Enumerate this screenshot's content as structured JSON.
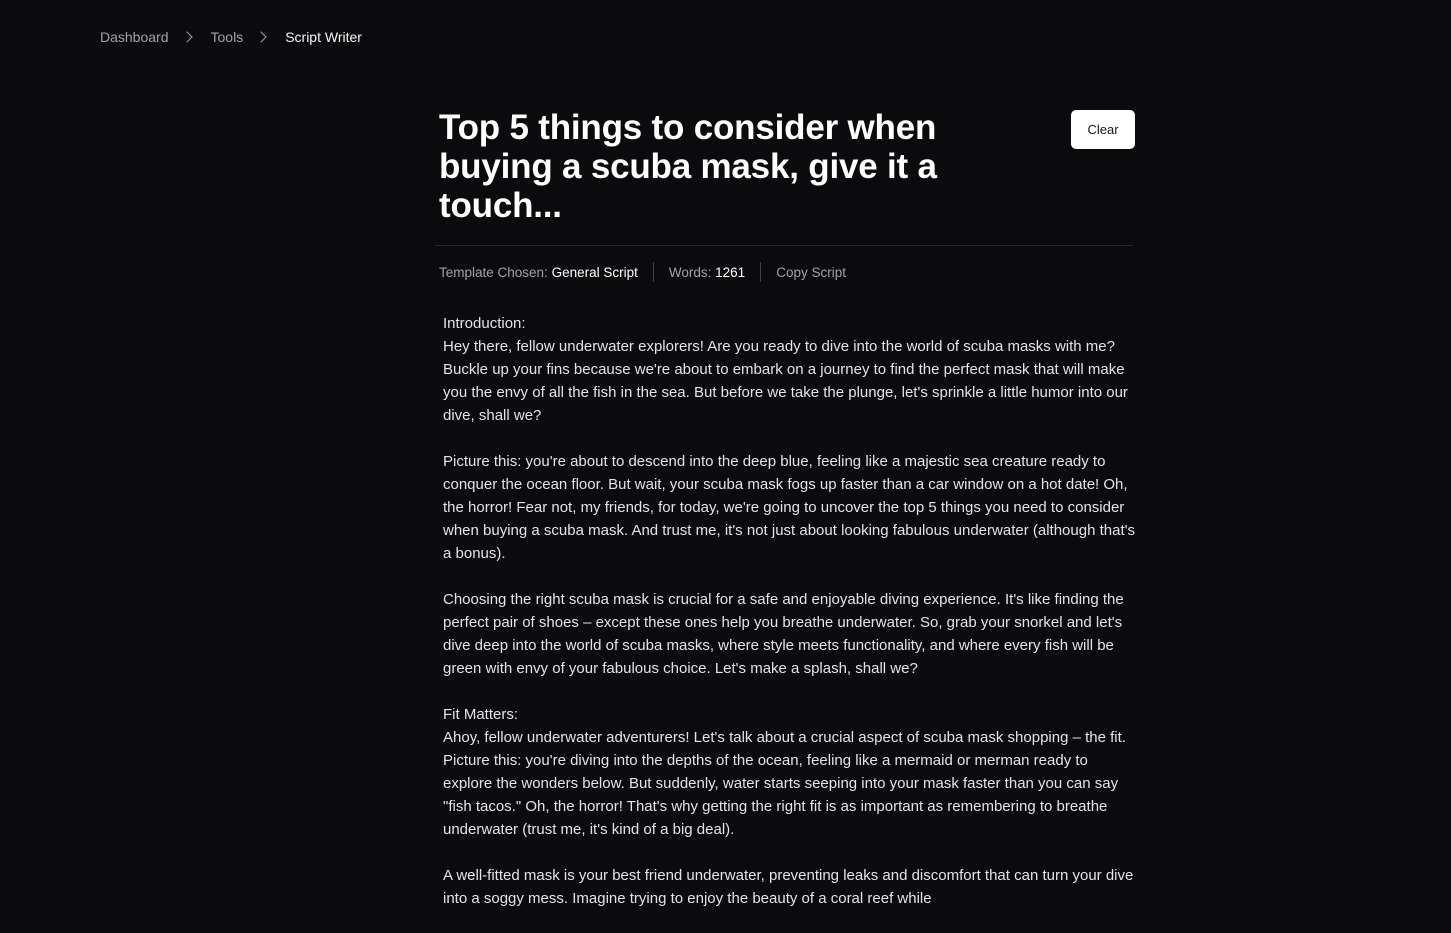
{
  "breadcrumb": {
    "items": [
      "Dashboard",
      "Tools"
    ],
    "current": "Script Writer"
  },
  "header": {
    "title": "Top 5 things to consider when buying a scuba mask, give it a touch...",
    "clear_label": "Clear"
  },
  "meta": {
    "template_label": "Template Chosen:",
    "template_value": "General Script",
    "words_label": "Words:",
    "words_value": "1261",
    "copy_label": "Copy Script"
  },
  "script": {
    "paragraphs": [
      {
        "heading": "Introduction:",
        "text": "Hey there, fellow underwater explorers! Are you ready to dive into the world of scuba masks with me? Buckle up your fins because we're about to embark on a journey to find the perfect mask that will make you the envy of all the fish in the sea. But before we take the plunge, let's sprinkle a little humor into our dive, shall we?"
      },
      {
        "heading": "",
        "text": "Picture this: you're about to descend into the deep blue, feeling like a majestic sea creature ready to conquer the ocean floor. But wait, your scuba mask fogs up faster than a car window on a hot date! Oh, the horror! Fear not, my friends, for today, we're going to uncover the top 5 things you need to consider when buying a scuba mask. And trust me, it's not just about looking fabulous underwater (although that's a bonus)."
      },
      {
        "heading": "",
        "text": "Choosing the right scuba mask is crucial for a safe and enjoyable diving experience. It's like finding the perfect pair of shoes – except these ones help you breathe underwater. So, grab your snorkel and let's dive deep into the world of scuba masks, where style meets functionality, and where every fish will be green with envy of your fabulous choice. Let's make a splash, shall we?"
      },
      {
        "heading": "Fit Matters:",
        "text": "Ahoy, fellow underwater adventurers! Let's talk about a crucial aspect of scuba mask shopping – the fit. Picture this: you're diving into the depths of the ocean, feeling like a mermaid or merman ready to explore the wonders below. But suddenly, water starts seeping into your mask faster than you can say \"fish tacos.\" Oh, the horror! That's why getting the right fit is as important as remembering to breathe underwater (trust me, it's kind of a big deal)."
      },
      {
        "heading": "",
        "text": "A well-fitted mask is your best friend underwater, preventing leaks and discomfort that can turn your dive into a soggy mess. Imagine trying to enjoy the beauty of a coral reef while"
      }
    ]
  }
}
